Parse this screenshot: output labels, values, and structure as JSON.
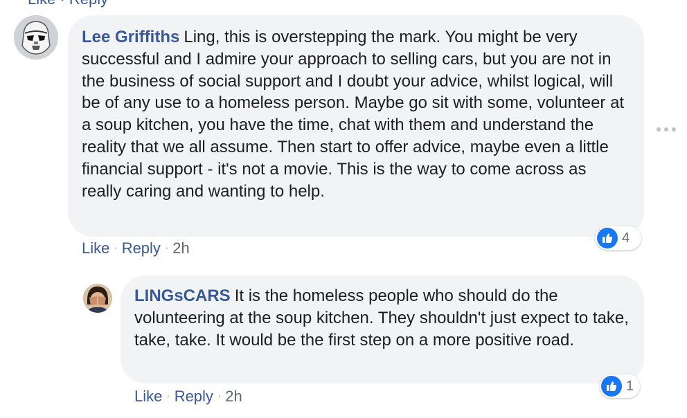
{
  "top_fragment": "Like · Reply",
  "comments": [
    {
      "author": "Lee Griffiths",
      "text": "Ling, this is overstepping the mark. You might be very successful and I admire your approach to selling cars, but you are not in the business of social support and I doubt your advice, whilst logical, will be of any use to a homeless person. Maybe go sit with some, volunteer at a soup kitchen, you have the time, chat with them and understand the reality that we all assume. Then start to offer advice, maybe even a little financial support - it's not a movie. This is the way to come across as really caring and wanting to help.",
      "like_label": "Like",
      "reply_label": "Reply",
      "separator": "·",
      "time": "2h",
      "reaction_count": "4",
      "avatar_icon": "stormtrooper-avatar-icon"
    },
    {
      "author": "LINGsCARS",
      "text": "It is the homeless people who should do the volunteering at the soup kitchen. They shouldn't just expect to take, take, take. It would be the first step on a more positive road.",
      "like_label": "Like",
      "reply_label": "Reply",
      "separator": "·",
      "time": "2h",
      "reaction_count": "1",
      "avatar_icon": "person-covering-face-avatar-icon"
    }
  ],
  "icons": {
    "reaction": "thumbs-up-icon",
    "more_options": "more-options-icon"
  },
  "colors": {
    "link": "#385898",
    "bubble": "#f2f3f5",
    "like_blue": "#1877f2",
    "meta_gray": "#606770"
  }
}
